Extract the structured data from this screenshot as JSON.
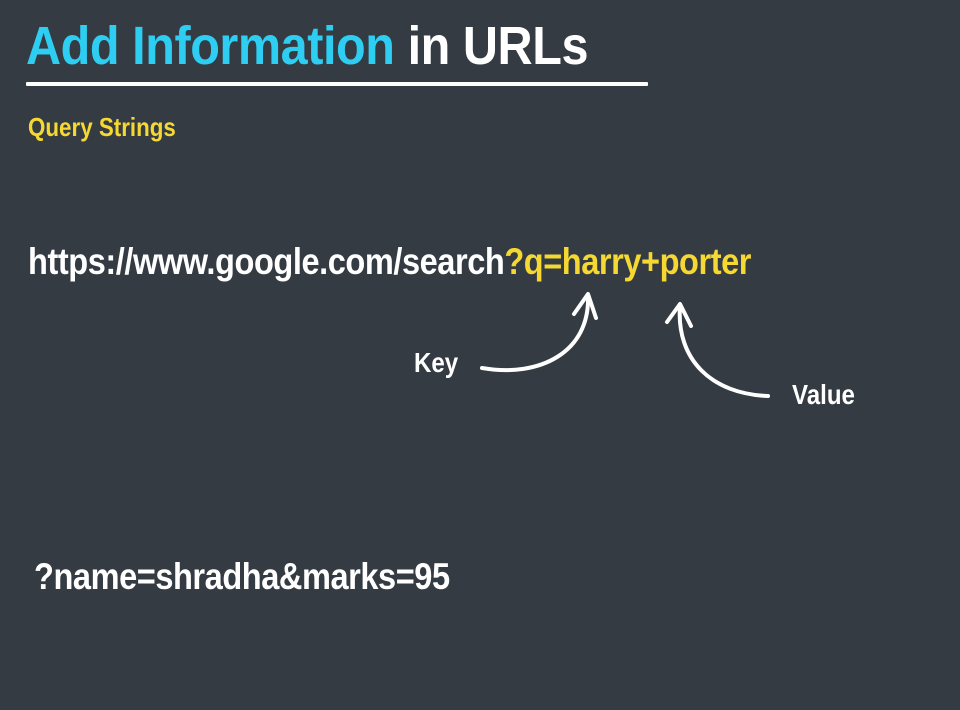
{
  "slide": {
    "title_accent": "Add Information",
    "title_rest": "in URLs",
    "subtitle": "Query Strings",
    "url": {
      "base": "https://www.google.com/search",
      "query": "?q=harry+porter"
    },
    "annotations": {
      "key": "Key",
      "value": "Value"
    },
    "example": "?name=shradha&marks=95"
  },
  "colors": {
    "background": "#353b43",
    "title_accent": "#2ecdf2",
    "highlight": "#f5d832",
    "text": "#ffffff"
  },
  "icons": {
    "key_arrow": "curved-arrow-up-icon",
    "value_arrow": "curved-arrow-up-icon"
  }
}
